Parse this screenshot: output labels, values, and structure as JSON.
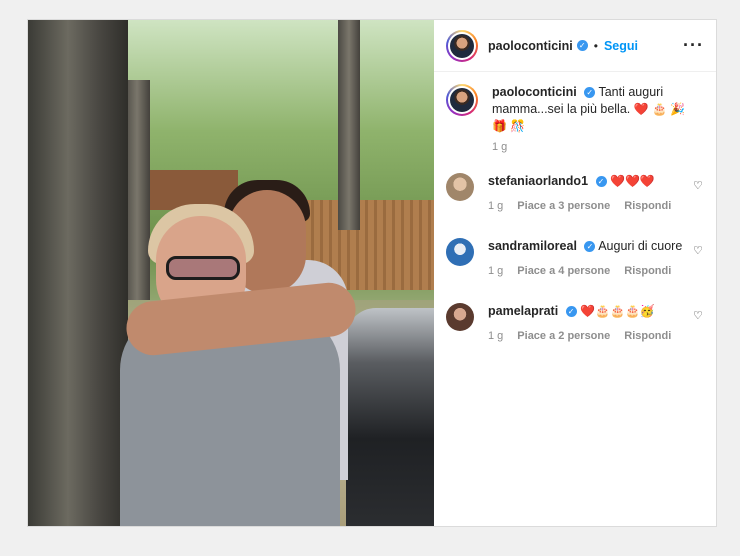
{
  "post": {
    "author": "paoloconticini",
    "follow_label": "Segui",
    "caption_prefix": "Tanti auguri",
    "caption_rest": "mamma...sei la più bella.",
    "caption_emojis_1": "❤️ 🎂 🎉",
    "caption_emojis_2": "🎁 🎊",
    "caption_time": "1 g"
  },
  "comments": [
    {
      "user": "stefaniaorlando1",
      "text": "❤️❤️❤️",
      "time": "1 g",
      "likes": "Piace a 3 persone",
      "reply": "Rispondi",
      "avatar_color": "#c9a789"
    },
    {
      "user": "sandramiloreal",
      "text": "Auguri di cuore",
      "time": "1 g",
      "likes": "Piace a 4 persone",
      "reply": "Rispondi",
      "avatar_color": "#2f6fb5"
    },
    {
      "user": "pamelaprati",
      "text": "❤️🎂🎂🎂🥳",
      "time": "1 g",
      "likes": "Piace a 2 persone",
      "reply": "Rispondi",
      "avatar_color": "#7a5546"
    }
  ],
  "icons": {
    "verified": "verified-badge-icon",
    "more": "more-options-icon",
    "heart": "heart-outline-icon"
  },
  "colors": {
    "follow": "#0095f6",
    "verified": "#3897f0"
  }
}
